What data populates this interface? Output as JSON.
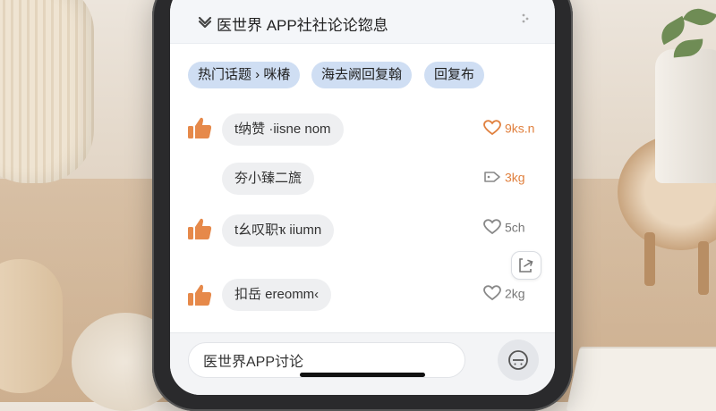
{
  "header": {
    "back_icon": "chevron-down-icon",
    "title": "医世界 APP社社论论锪息",
    "more_icon": "more-icon"
  },
  "tabs": [
    {
      "label": "热门话题 › 咪椿"
    },
    {
      "label": "海去阙回复翰"
    },
    {
      "label": "回复布"
    }
  ],
  "posts": [
    {
      "text": "t纳赞 ·iisne nom",
      "liked": true,
      "stat_icon": "heart-icon",
      "stat": "9ks.n",
      "stat_color": "#e0803e"
    },
    {
      "text": "夯小臻二旒",
      "liked": false,
      "stat_icon": "tag-icon",
      "stat": "3kg",
      "stat_color": "#e0803e"
    },
    {
      "text": "t幺叹职ҡ iiumn",
      "liked": true,
      "stat_icon": "heart-icon",
      "stat": "5ch",
      "stat_color": "#777777"
    },
    {
      "text": "扣岳 ereomm‹",
      "liked": true,
      "stat_icon": "heart-icon",
      "stat": "2kg",
      "stat_color": "#777777"
    }
  ],
  "share_icon": "share-icon",
  "composer": {
    "value": "医世界APP讨论",
    "emoji_icon": "emoji-icon"
  },
  "colors": {
    "accent": "#e0803e",
    "tab_bg": "#cfdef3",
    "bubble_bg": "#eeeff1"
  }
}
